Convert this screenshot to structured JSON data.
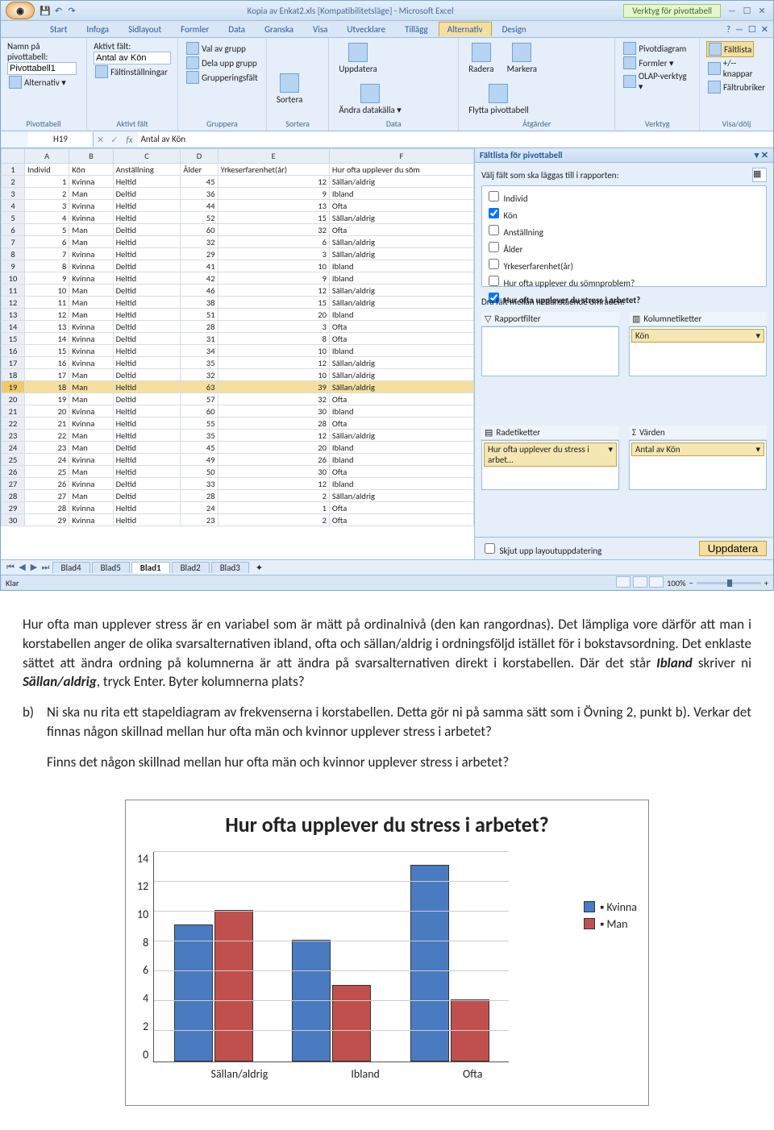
{
  "window": {
    "title": "Kopia av Enkat2.xls [Kompatibilitetsläge] - Microsoft Excel",
    "context_tab": "Verktyg för pivottabell"
  },
  "tabs": [
    "Start",
    "Infoga",
    "Sidlayout",
    "Formler",
    "Data",
    "Granska",
    "Visa",
    "Utvecklare",
    "Tillägg",
    "Alternativ",
    "Design"
  ],
  "active_tab": "Alternativ",
  "ribbon": {
    "pivottable": {
      "label": "Pivottabell",
      "name_label": "Namn på pivottabell:",
      "name_value": "Pivottabell1",
      "options": "Alternativ ▾"
    },
    "activefield": {
      "label": "Aktivt fält",
      "af_label": "Aktivt fält:",
      "af_value": "Antal av Kön",
      "settings": "Fältinställningar"
    },
    "group": {
      "label": "Gruppera",
      "b1": "Val av grupp",
      "b2": "Dela upp grupp",
      "b3": "Grupperingsfält"
    },
    "sort": {
      "label": "Sortera",
      "btn": "Sortera"
    },
    "data": {
      "label": "Data",
      "b1": "Uppdatera",
      "b2": "Ändra datakälla ▾"
    },
    "actions": {
      "label": "Åtgärder",
      "b1": "Radera",
      "b2": "Markera",
      "b3": "Flytta pivottabell"
    },
    "tools": {
      "label": "Verktyg",
      "b1": "Pivotdiagram",
      "b2": "Formler ▾",
      "b3": "OLAP-verktyg ▾"
    },
    "show": {
      "label": "Visa/dölj",
      "b1": "Fältlista",
      "b2": "+/--knappar",
      "b3": "Fältrubriker"
    }
  },
  "namebox": "H19",
  "formula": "Antal av Kön",
  "col_letters": [
    "A",
    "B",
    "C",
    "D",
    "E",
    "F"
  ],
  "headers": [
    "Individ",
    "Kön",
    "Anställning",
    "Ålder",
    "Yrkeserfarenhet(år)",
    "Hur ofta upplever du söm"
  ],
  "rows": [
    [
      1,
      "Kvinna",
      "Heltid",
      45,
      12,
      "Sällan/aldrig"
    ],
    [
      2,
      "Man",
      "Deltid",
      36,
      9,
      "Ibland"
    ],
    [
      3,
      "Kvinna",
      "Heltid",
      44,
      13,
      "Ofta"
    ],
    [
      4,
      "Kvinna",
      "Heltid",
      52,
      15,
      "Sällan/aldrig"
    ],
    [
      5,
      "Man",
      "Deltid",
      60,
      32,
      "Ofta"
    ],
    [
      6,
      "Man",
      "Heltid",
      32,
      6,
      "Sällan/aldrig"
    ],
    [
      7,
      "Kvinna",
      "Heltid",
      29,
      3,
      "Sällan/aldrig"
    ],
    [
      8,
      "Kvinna",
      "Deltid",
      41,
      10,
      "Ibland"
    ],
    [
      9,
      "Kvinna",
      "Heltid",
      42,
      9,
      "Ibland"
    ],
    [
      10,
      "Man",
      "Deltid",
      46,
      12,
      "Sällan/aldrig"
    ],
    [
      11,
      "Man",
      "Heltid",
      38,
      15,
      "Sällan/aldrig"
    ],
    [
      12,
      "Man",
      "Heltid",
      51,
      20,
      "Ibland"
    ],
    [
      13,
      "Kvinna",
      "Deltid",
      28,
      3,
      "Ofta"
    ],
    [
      14,
      "Kvinna",
      "Deltid",
      31,
      8,
      "Ofta"
    ],
    [
      15,
      "Kvinna",
      "Heltid",
      34,
      10,
      "Ibland"
    ],
    [
      16,
      "Kvinna",
      "Heltid",
      35,
      12,
      "Sällan/aldrig"
    ],
    [
      17,
      "Man",
      "Deltid",
      32,
      10,
      "Sällan/aldrig"
    ],
    [
      18,
      "Man",
      "Heltid",
      63,
      39,
      "Sällan/aldrig"
    ],
    [
      19,
      "Man",
      "Deltid",
      57,
      32,
      "Ofta"
    ],
    [
      20,
      "Kvinna",
      "Heltid",
      60,
      30,
      "Ibland"
    ],
    [
      21,
      "Kvinna",
      "Heltid",
      55,
      28,
      "Ofta"
    ],
    [
      22,
      "Man",
      "Heltid",
      35,
      12,
      "Sällan/aldrig"
    ],
    [
      23,
      "Man",
      "Deltid",
      45,
      20,
      "Ibland"
    ],
    [
      24,
      "Kvinna",
      "Heltid",
      49,
      26,
      "Ibland"
    ],
    [
      25,
      "Man",
      "Heltid",
      50,
      30,
      "Ofta"
    ],
    [
      26,
      "Kvinna",
      "Deltid",
      33,
      12,
      "Ibland"
    ],
    [
      27,
      "Man",
      "Deltid",
      28,
      2,
      "Sällan/aldrig"
    ],
    [
      28,
      "Kvinna",
      "Heltid",
      24,
      1,
      "Ofta"
    ],
    [
      29,
      "Kvinna",
      "Heltid",
      23,
      2,
      "Ofta"
    ]
  ],
  "selected_row_index": 17,
  "sheets": [
    "Blad4",
    "Blad5",
    "Blad1",
    "Blad2",
    "Blad3"
  ],
  "active_sheet": "Blad1",
  "pane": {
    "title": "Fältlista för pivottabell",
    "instruction": "Välj fält som ska läggas till i rapporten:",
    "fields": [
      {
        "label": "Individ",
        "checked": false
      },
      {
        "label": "Kön",
        "checked": true
      },
      {
        "label": "Anställning",
        "checked": false
      },
      {
        "label": "Ålder",
        "checked": false
      },
      {
        "label": "Yrkeserfarenhet(år)",
        "checked": false
      },
      {
        "label": "Hur ofta upplever du sömnproblem?",
        "checked": false
      },
      {
        "label": "Hur ofta upplever du stress i arbetet?",
        "checked": true
      }
    ],
    "drag_label": "Dra fält mellan nedanstående områden:",
    "filter_label": "Rapportfilter",
    "cols_label": "Kolumnetiketter",
    "rows_label": "Radetiketter",
    "vals_label": "Värden",
    "cols_item": "Kön",
    "rows_item": "Hur ofta upplever du stress i arbet…",
    "vals_item": "Antal av Kön",
    "defer": "Skjut upp layoutuppdatering",
    "update": "Uppdatera"
  },
  "status": {
    "ready": "Klar",
    "zoom": "100%"
  },
  "doc": {
    "p1a": "Hur ofta man upplever stress är en variabel som är mätt på ordinalnivå (den kan rangordnas). Det lämpliga vore därför att man i korstabellen anger de olika svarsalternativen ibland, ofta och sällan/aldrig i ordningsföljd istället för i bokstavsordning. Det enklaste sättet att ändra ordning på kolumnerna är att ändra på svarsalternativen direkt i korstabellen. Där det står ",
    "p1b": "Ibland",
    "p1c": " skriver ni ",
    "p1d": "Sällan/aldrig",
    "p1e": ", tryck Enter. Byter kolumnerna plats?",
    "qb_marker": "b)",
    "qb": "Ni ska nu rita ett stapeldiagram av frekvenserna i korstabellen. Detta gör ni på samma sätt som i Övning 2, punkt b). Verkar det finnas någon skillnad mellan hur ofta män och kvinnor upplever stress i arbetet?",
    "final": "Finns det någon skillnad mellan hur ofta män och kvinnor upplever stress i arbetet?"
  },
  "chart_data": {
    "type": "bar",
    "title": "Hur ofta upplever du stress i arbetet?",
    "categories": [
      "Sällan/aldrig",
      "Ibland",
      "Ofta"
    ],
    "series": [
      {
        "name": "Kvinna",
        "values": [
          9,
          8,
          13
        ],
        "color": "#4a7bc0"
      },
      {
        "name": "Man",
        "values": [
          10,
          5,
          4
        ],
        "color": "#c0504d"
      }
    ],
    "ylim": [
      0,
      14
    ],
    "yticks": [
      0,
      2,
      4,
      6,
      8,
      10,
      12,
      14
    ]
  }
}
